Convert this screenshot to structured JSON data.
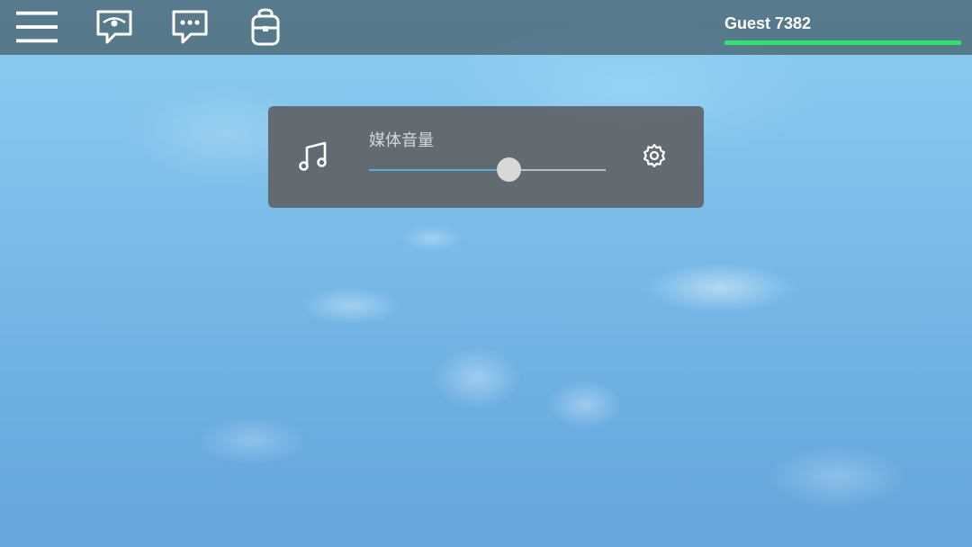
{
  "topbar": {
    "icons": [
      "menu-icon",
      "chat-bubble-eye-icon",
      "chat-bubble-ellipsis-icon",
      "backpack-icon"
    ],
    "player_name": "Guest 7382",
    "health_fraction": 1.0,
    "health_color": "#2ee56a"
  },
  "volume_panel": {
    "icon": "music-note-icon",
    "label": "媒体音量",
    "value_fraction": 0.59,
    "settings_icon": "gear-icon",
    "fill_color": "#4fb3d9"
  }
}
